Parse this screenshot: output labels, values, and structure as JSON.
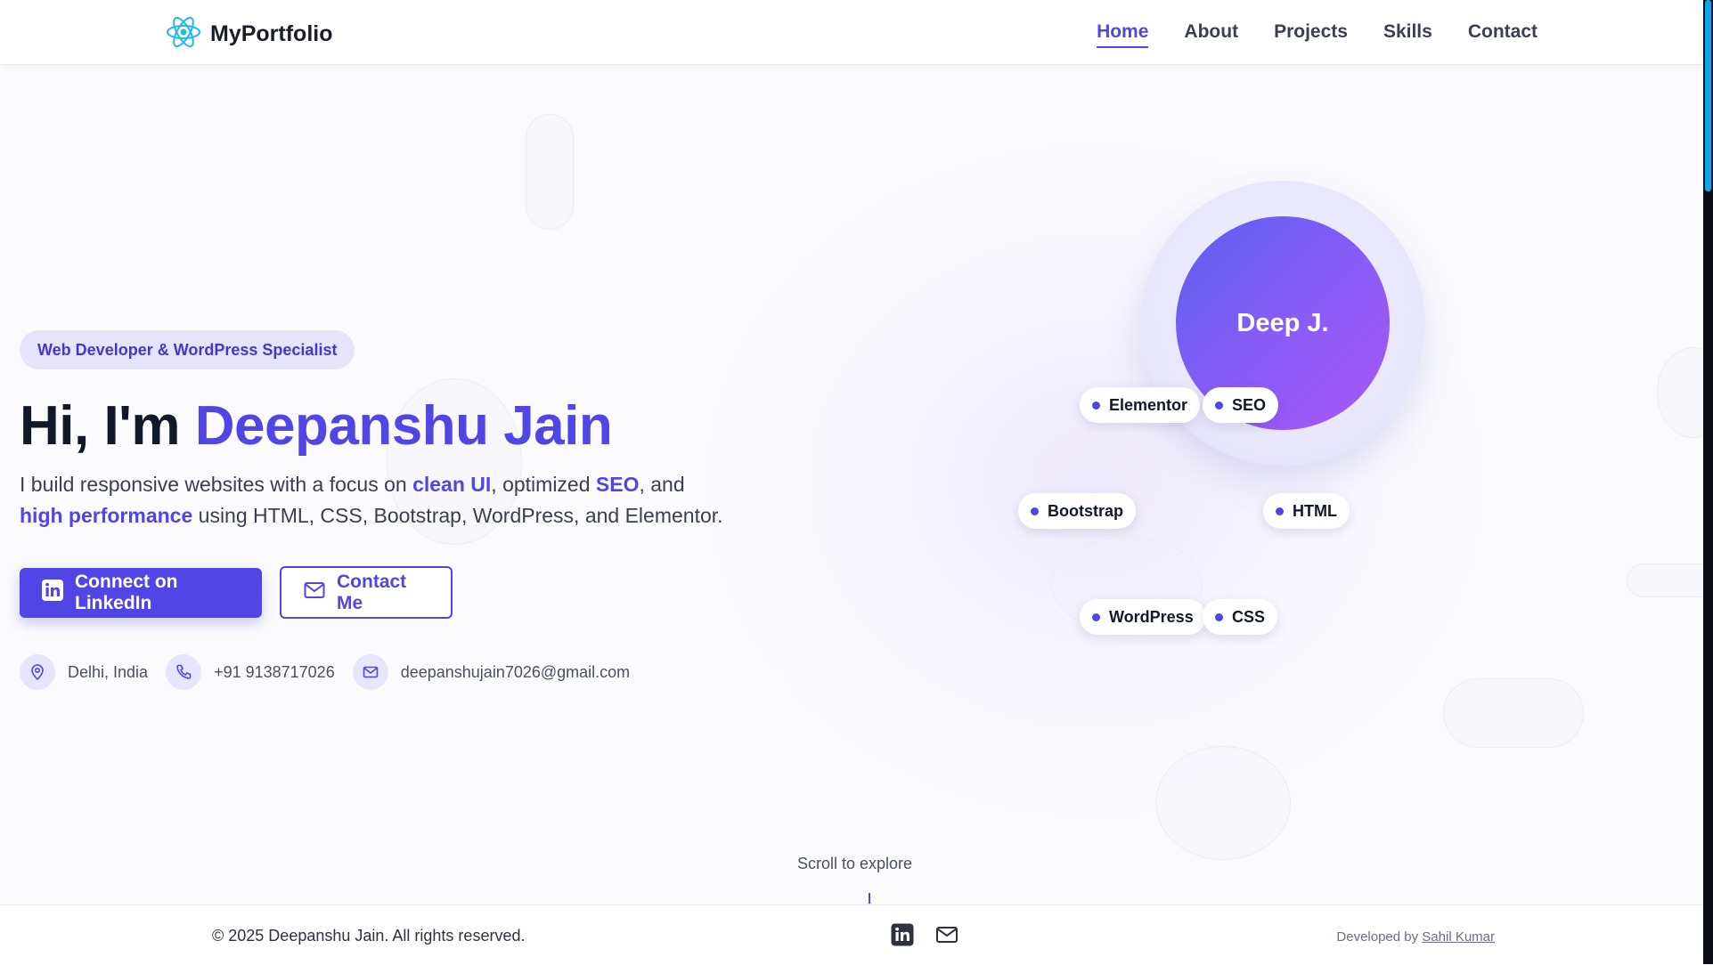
{
  "header": {
    "brand": "MyPortfolio",
    "nav": [
      "Home",
      "About",
      "Projects",
      "Skills",
      "Contact"
    ],
    "active_nav": "Home"
  },
  "hero": {
    "role_badge": "Web Developer & WordPress Specialist",
    "headline_prefix": "Hi, I'm ",
    "headline_name": "Deepanshu Jain",
    "intro": {
      "t1": "I build responsive websites with a focus on ",
      "h1": "clean UI",
      "t2": ", optimized ",
      "h2": "SEO",
      "t3": ", and ",
      "h3": "high performance",
      "t4": " using HTML, CSS, Bootstrap, WordPress, and Elementor."
    },
    "buttons": {
      "linkedin": "Connect on LinkedIn",
      "contact": "Contact Me"
    },
    "contact": {
      "location": "Delhi, India",
      "phone": "+91 9138717026",
      "email": "deepanshujain7026@gmail.com"
    },
    "avatar_text": "Deep J.",
    "skill_tags": [
      "Elementor",
      "SEO",
      "Bootstrap",
      "HTML",
      "WordPress",
      "CSS"
    ],
    "scroll_hint": "Scroll to explore"
  },
  "footer": {
    "copyright": "© 2025 Deepanshu Jain. All rights reserved.",
    "developed_by": "Developed by",
    "developer": "Sahil Kumar",
    "icons": [
      "linkedin-icon",
      "mail-icon"
    ]
  },
  "colors": {
    "accent": "#4f46e5",
    "avatar_gradient_start": "#5b5ff0",
    "avatar_gradient_end": "#a855f7",
    "badge_bg": "#e5e4fb",
    "text_dark": "#111827"
  }
}
